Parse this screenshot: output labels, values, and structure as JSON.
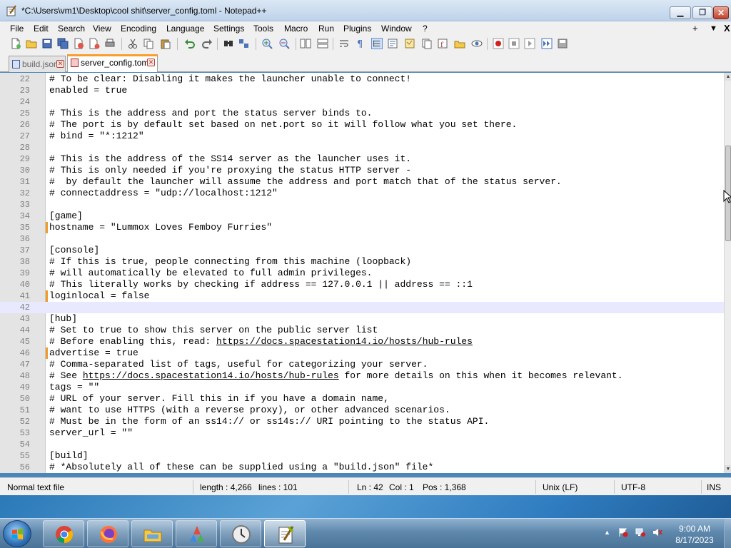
{
  "window": {
    "title": "*C:\\Users\\vm1\\Desktop\\cool shit\\server_config.toml - Notepad++"
  },
  "menu": {
    "items": [
      "File",
      "Edit",
      "Search",
      "View",
      "Encoding",
      "Language",
      "Settings",
      "Tools",
      "Macro",
      "Run",
      "Plugins",
      "Window",
      "?"
    ],
    "right": [
      "+",
      "▼",
      "X"
    ]
  },
  "tabs": [
    {
      "label": "build.json",
      "active": false
    },
    {
      "label": "server_config.toml",
      "active": true
    }
  ],
  "editor": {
    "current_line": 42,
    "lines": [
      {
        "n": "22",
        "text": "# To be clear: Disabling it makes the launcher unable to connect!"
      },
      {
        "n": "23",
        "text": "enabled = true"
      },
      {
        "n": "24",
        "text": ""
      },
      {
        "n": "25",
        "text": "# This is the address and port the status server binds to."
      },
      {
        "n": "26",
        "text": "# The port is by default set based on net.port so it will follow what you set there."
      },
      {
        "n": "27",
        "text": "# bind = \"*:1212\""
      },
      {
        "n": "28",
        "text": ""
      },
      {
        "n": "29",
        "text": "# This is the address of the SS14 server as the launcher uses it."
      },
      {
        "n": "30",
        "text": "# This is only needed if you're proxying the status HTTP server -"
      },
      {
        "n": "31",
        "text": "#  by default the launcher will assume the address and port match that of the status server."
      },
      {
        "n": "32",
        "text": "# connectaddress = \"udp://localhost:1212\""
      },
      {
        "n": "33",
        "text": ""
      },
      {
        "n": "34",
        "text": "[game]"
      },
      {
        "n": "35",
        "text": "hostname = \"Lummox Loves Femboy Furries\"",
        "changed": true
      },
      {
        "n": "36",
        "text": ""
      },
      {
        "n": "37",
        "text": "[console]"
      },
      {
        "n": "38",
        "text": "# If this is true, people connecting from this machine (loopback)"
      },
      {
        "n": "39",
        "text": "# will automatically be elevated to full admin privileges."
      },
      {
        "n": "40",
        "text": "# This literally works by checking if address == 127.0.0.1 || address == ::1"
      },
      {
        "n": "41",
        "text": "loginlocal = false",
        "changed": true
      },
      {
        "n": "42",
        "text": ""
      },
      {
        "n": "43",
        "text": "[hub]"
      },
      {
        "n": "44",
        "text": "# Set to true to show this server on the public server list"
      },
      {
        "n": "45",
        "text": "# Before enabling this, read: ",
        "link": "https://docs.spacestation14.io/hosts/hub-rules",
        "after": ""
      },
      {
        "n": "46",
        "text": "advertise = true",
        "changed": true
      },
      {
        "n": "47",
        "text": "# Comma-separated list of tags, useful for categorizing your server."
      },
      {
        "n": "48",
        "text": "# See ",
        "link": "https://docs.spacestation14.io/hosts/hub-rules",
        "after": " for more details on this when it becomes relevant."
      },
      {
        "n": "49",
        "text": "tags = \"\""
      },
      {
        "n": "50",
        "text": "# URL of your server. Fill this in if you have a domain name,"
      },
      {
        "n": "51",
        "text": "# want to use HTTPS (with a reverse proxy), or other advanced scenarios."
      },
      {
        "n": "52",
        "text": "# Must be in the form of an ss14:// or ss14s:// URI pointing to the status API."
      },
      {
        "n": "53",
        "text": "server_url = \"\""
      },
      {
        "n": "54",
        "text": ""
      },
      {
        "n": "55",
        "text": "[build]"
      },
      {
        "n": "56",
        "text": "# *Absolutely all of these can be supplied using a \"build.json\" file*"
      }
    ]
  },
  "statusbar": {
    "type": "Normal text file",
    "length": "length : 4,266",
    "lines": "lines : 101",
    "ln": "Ln : 42",
    "col": "Col : 1",
    "pos": "Pos : 1,368",
    "eol": "Unix (LF)",
    "encoding": "UTF-8",
    "mode": "INS"
  },
  "taskbar": {
    "time": "9:00 AM",
    "date": "8/17/2023",
    "apps": [
      "chrome-icon",
      "firefox-icon",
      "explorer-icon",
      "paint-icon",
      "clock-app-icon",
      "notepadpp-icon"
    ]
  },
  "colors": {
    "active_tab_accent": "#fa9d2c",
    "change_marker": "#f39a2c",
    "current_line": "#e8e8ff"
  }
}
